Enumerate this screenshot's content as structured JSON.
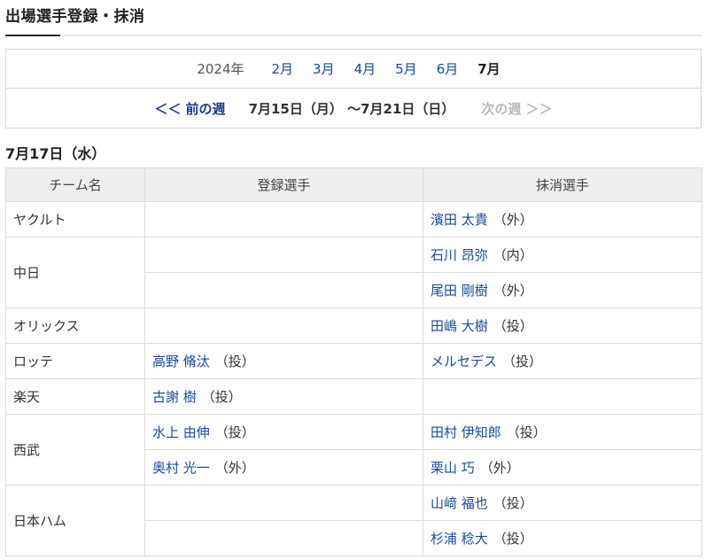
{
  "page": {
    "title": "出場選手登録・抹消"
  },
  "month_nav": {
    "year": "2024年",
    "months": [
      "2月",
      "3月",
      "4月",
      "5月",
      "6月",
      "7月"
    ],
    "current": "7月"
  },
  "week_nav": {
    "prev": "＜＜ 前の週",
    "range": "7月15日（月） ～7月21日（日）",
    "next": "次の週 ＞＞"
  },
  "day": {
    "date": "7月17日（水）"
  },
  "table": {
    "headers": {
      "team": "チーム名",
      "registered": "登録選手",
      "removed": "抹消選手"
    },
    "teams": [
      {
        "name": "ヤクルト",
        "rows": [
          {
            "reg": null,
            "rem": {
              "name": "濱田 太貴",
              "pos": "（外）"
            }
          }
        ]
      },
      {
        "name": "中日",
        "rows": [
          {
            "reg": null,
            "rem": {
              "name": "石川 昂弥",
              "pos": "（内）"
            }
          },
          {
            "reg": null,
            "rem": {
              "name": "尾田 剛樹",
              "pos": "（外）"
            }
          }
        ]
      },
      {
        "name": "オリックス",
        "rows": [
          {
            "reg": null,
            "rem": {
              "name": "田嶋 大樹",
              "pos": "（投）"
            }
          }
        ]
      },
      {
        "name": "ロッテ",
        "rows": [
          {
            "reg": {
              "name": "高野 脩汰",
              "pos": "（投）"
            },
            "rem": {
              "name": "メルセデス",
              "pos": "（投）"
            }
          }
        ]
      },
      {
        "name": "楽天",
        "rows": [
          {
            "reg": {
              "name": "古謝 樹",
              "pos": "（投）"
            },
            "rem": null
          }
        ]
      },
      {
        "name": "西武",
        "rows": [
          {
            "reg": {
              "name": "水上 由伸",
              "pos": "（投）"
            },
            "rem": {
              "name": "田村 伊知郎",
              "pos": "（投）"
            }
          },
          {
            "reg": {
              "name": "奥村 光一",
              "pos": "（外）"
            },
            "rem": {
              "name": "栗山 巧",
              "pos": "（外）"
            }
          }
        ]
      },
      {
        "name": "日本ハム",
        "rows": [
          {
            "reg": null,
            "rem": {
              "name": "山﨑 福也",
              "pos": "（投）"
            }
          },
          {
            "reg": null,
            "rem": {
              "name": "杉浦 稔大",
              "pos": "（投）"
            }
          }
        ]
      }
    ]
  }
}
